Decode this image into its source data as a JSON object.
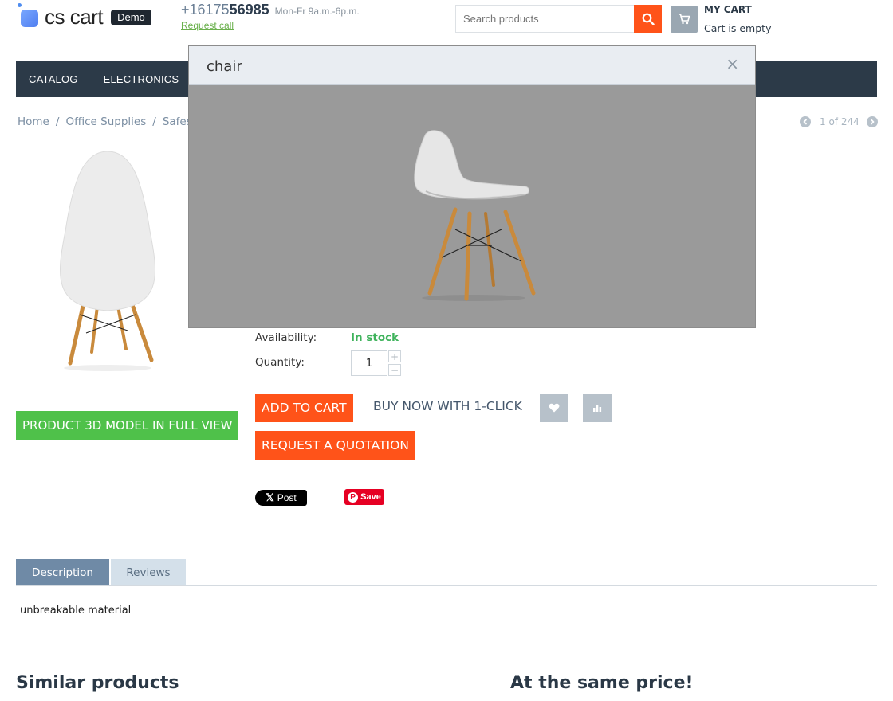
{
  "header": {
    "logo_text": "cs cart",
    "logo_badge": "Demo",
    "phone_prefix": "+16175",
    "phone_strong": "56985",
    "phone_hours": "Mon-Fr 9a.m.-6p.m.",
    "request_call": "Request call",
    "search_placeholder": "Search products",
    "cart_title": "MY CART",
    "cart_status": "Cart is empty"
  },
  "nav": {
    "items": [
      "CATALOG",
      "ELECTRONICS"
    ]
  },
  "breadcrumb": {
    "items": [
      "Home",
      "Office Supplies",
      "Safes"
    ],
    "separator": "/"
  },
  "pager": {
    "text": "1 of 244"
  },
  "product": {
    "availability_label": "Availability:",
    "availability_value": "In stock",
    "quantity_label": "Quantity:",
    "quantity_value": "1",
    "qty_plus": "+",
    "qty_minus": "−",
    "btn_3d": "PRODUCT 3D MODEL IN FULL VIEW",
    "add_to_cart": "ADD TO CART",
    "buy_now": "BUY NOW WITH 1-CLICK",
    "request_quotation": "REQUEST A QUOTATION",
    "x_post": "Post",
    "pin_save": "Save"
  },
  "tabs": {
    "items": [
      "Description",
      "Reviews"
    ],
    "active": "Description",
    "description_text": "unbreakable material"
  },
  "sections": {
    "similar": "Similar products",
    "same_price": "At the same price!"
  },
  "modal": {
    "title": "chair",
    "close": "×"
  },
  "colors": {
    "accent": "#ff5319",
    "nav_bg": "#2c3a48",
    "green": "#4fc14a",
    "in_stock": "#3fb35c"
  }
}
